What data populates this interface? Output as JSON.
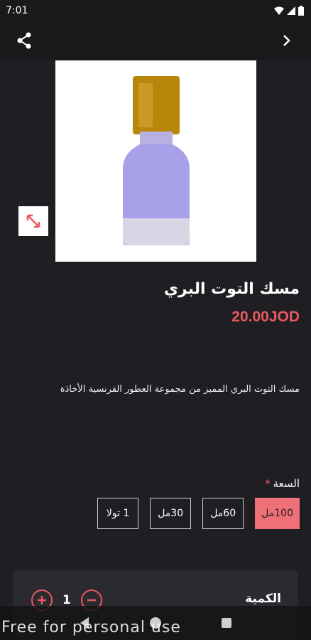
{
  "status_bar": {
    "time": "7:01"
  },
  "product": {
    "title": "مسك التوت البري",
    "price": "20.00JOD",
    "description": "مسك التوت البري المميز من مجموعة العطور الفرنسية الأخاذة"
  },
  "options": {
    "label": "السعة",
    "required_mark": "*",
    "items": [
      "100مل",
      "60مل",
      "30مل",
      "1 تولا"
    ],
    "selected_index": 0
  },
  "quantity": {
    "label": "الكمية",
    "value": "1"
  },
  "watermark": "Free for personal use",
  "colors": {
    "accent": "#e8575f",
    "selected_option": "#f07077",
    "background": "#1f1f23"
  }
}
